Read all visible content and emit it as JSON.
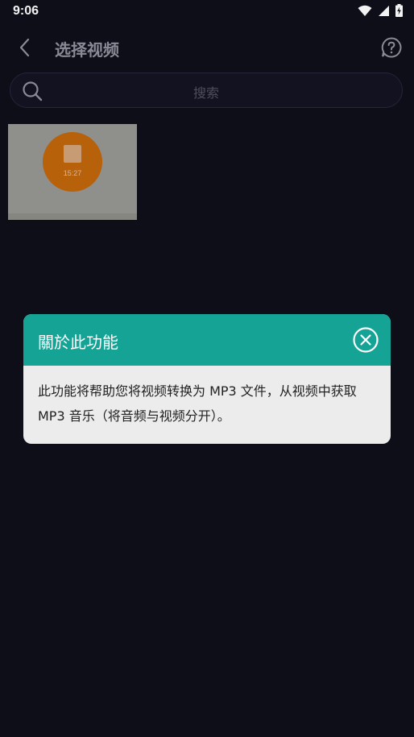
{
  "status_bar": {
    "time": "9:06",
    "icons": [
      "wifi-icon",
      "signal-icon",
      "battery-charging-icon"
    ]
  },
  "header": {
    "back_icon": "chevron-left-icon",
    "title": "选择视频",
    "help_icon": "question-bubble-icon"
  },
  "search": {
    "placeholder": "搜索",
    "icon": "search-icon"
  },
  "videos": [
    {
      "thumbnail_time": "15:27"
    }
  ],
  "dialog": {
    "title": "關於此功能",
    "close_icon": "close-circle-icon",
    "message": "此功能将帮助您将视频转换为 MP3 文件，从视频中获取 MP3 音乐（将音频与视频分开）。"
  },
  "colors": {
    "background": "#0e0e19",
    "dialog_header": "#14a395",
    "dialog_body": "#ececec",
    "thumbnail_accent": "#b7610b"
  }
}
